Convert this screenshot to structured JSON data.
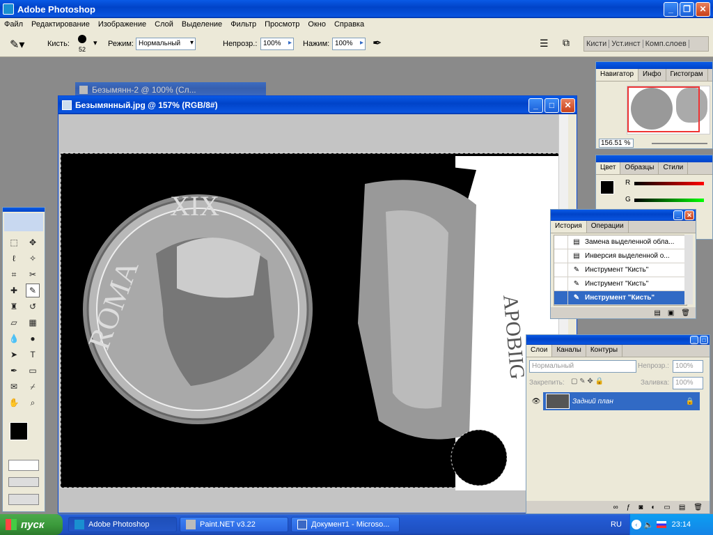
{
  "app": {
    "title": "Adobe Photoshop"
  },
  "menu": [
    "Файл",
    "Редактирование",
    "Изображение",
    "Слой",
    "Выделение",
    "Фильтр",
    "Просмотр",
    "Окно",
    "Справка"
  ],
  "options": {
    "brush_label": "Кисть:",
    "brush_size": "52",
    "mode_label": "Режим:",
    "mode_value": "Нормальный",
    "opacity_label": "Непрозр.:",
    "opacity_value": "100%",
    "flow_label": "Нажим:",
    "flow_value": "100%",
    "right_tabs": [
      "Кисти",
      "Уст.инст",
      "Комп.слоев"
    ]
  },
  "doc_back": {
    "title": "Безымянн-2 @ 100% (Сл..."
  },
  "doc": {
    "title": "Безымянный.jpg @ 157% (RGB/8#)",
    "roma": "ROMA",
    "roma_letters": [
      "R",
      "O",
      "M",
      "A"
    ],
    "xix": "XIX",
    "reverse_text": "APOBIIG"
  },
  "navigator": {
    "tabs": [
      "Навигатор",
      "Инфо",
      "Гистограм"
    ],
    "zoom": "156.51 %"
  },
  "color": {
    "tabs": [
      "Цвет",
      "Образцы",
      "Стили"
    ],
    "channels": [
      "R",
      "G"
    ]
  },
  "history": {
    "tabs": [
      "История",
      "Операции"
    ],
    "items": [
      {
        "label": "Замена выделенной обла...",
        "selected": false
      },
      {
        "label": "Инверсия выделенной о...",
        "selected": false
      },
      {
        "label": "Инструмент \"Кисть\"",
        "selected": false
      },
      {
        "label": "Инструмент \"Кисть\"",
        "selected": false
      },
      {
        "label": "Инструмент \"Кисть\"",
        "selected": true
      }
    ]
  },
  "layers": {
    "tabs": [
      "Слои",
      "Каналы",
      "Контуры"
    ],
    "blend": "Нормальный",
    "opacity_label": "Непрозр.:",
    "opacity_value": "100%",
    "lock_label": "Закрепить:",
    "fill_label": "Заливка:",
    "fill_value": "100%",
    "layer_name": "Задний план"
  },
  "taskbar": {
    "start": "пуск",
    "tasks": [
      "Adobe Photoshop",
      "Paint.NET v3.22",
      "Документ1 - Microso..."
    ],
    "lang": "RU",
    "time": "23:14"
  },
  "colors": {
    "xp_blue": "#0a5ae6",
    "selection": "#316ac5",
    "start_green": "#3c9b3c"
  }
}
